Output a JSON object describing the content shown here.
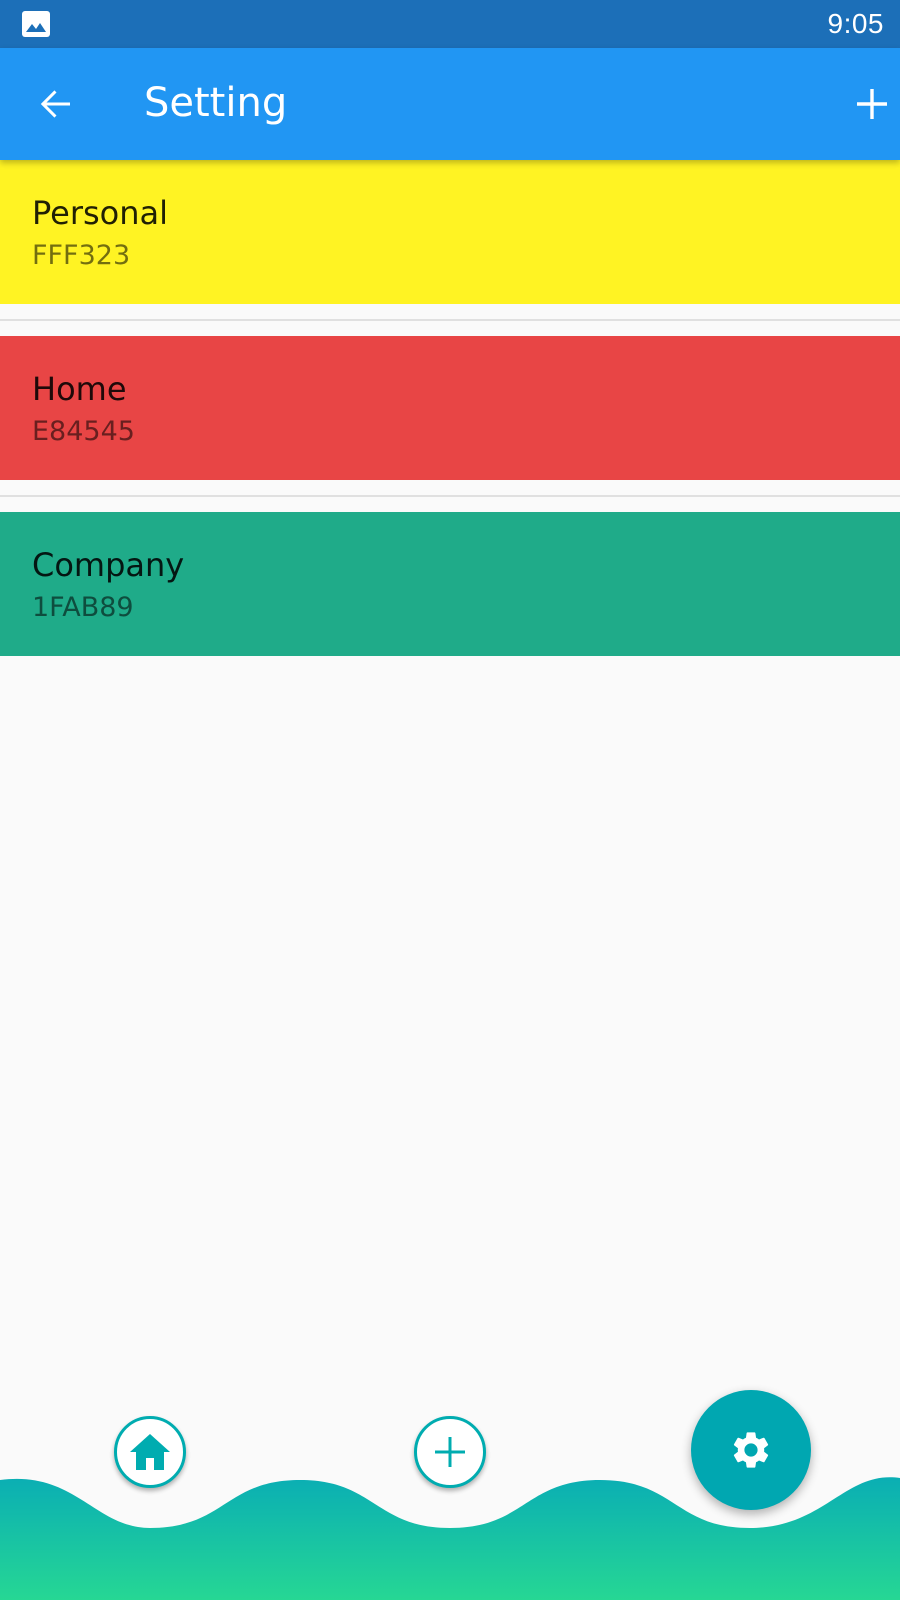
{
  "status_bar": {
    "time": "9:05",
    "notification_icon": "image-icon"
  },
  "app_bar": {
    "title": "Setting",
    "back_icon": "arrow-back-icon",
    "add_icon": "plus-icon",
    "color": "#2196f3"
  },
  "categories": [
    {
      "name": "Personal",
      "code": "FFF323",
      "color": "#FFF323"
    },
    {
      "name": "Home",
      "code": "E84545",
      "color": "#E84545"
    },
    {
      "name": "Company",
      "code": "1FAB89",
      "color": "#1FAB89"
    }
  ],
  "bottom_nav": {
    "items": [
      {
        "icon": "home-icon"
      },
      {
        "icon": "plus-icon"
      },
      {
        "icon": "gear-icon",
        "selected": true
      }
    ],
    "accent": "#00acb0",
    "wave_gradient": [
      "#0aaeb4",
      "#26d794"
    ]
  }
}
